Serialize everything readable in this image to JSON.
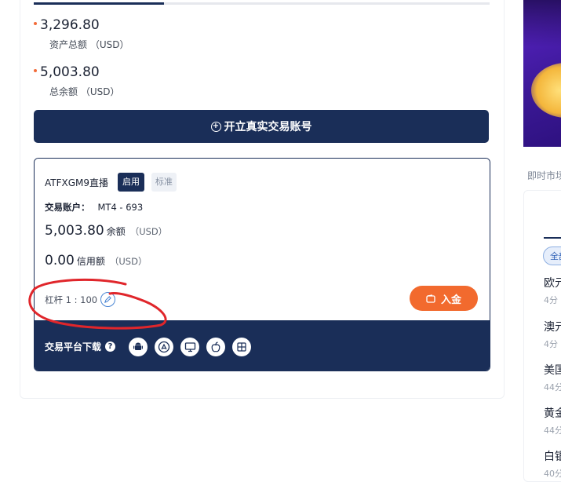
{
  "summary": {
    "total_assets": {
      "value": "3,296.80",
      "label": "资产总额 （USD）"
    },
    "total_balance": {
      "value": "5,003.80",
      "label": "总余额 （USD）"
    }
  },
  "open_account_button": {
    "icon": "plus-circle-icon",
    "label": "开立真实交易账号"
  },
  "account": {
    "name": "ATFXGM9直播",
    "status_badge": "启用",
    "type_badge": "标准",
    "account_label": "交易账户：",
    "account_value": "MT4 - 693",
    "balance": {
      "value": "5,003.80",
      "unit": "余额",
      "currency": "（USD）"
    },
    "credit": {
      "value": "0.00",
      "unit": "信用额",
      "currency": "（USD）"
    },
    "leverage": "杠杆 1 : 100",
    "deposit_button": "入金"
  },
  "platform_download": {
    "label": "交易平台下载",
    "icons": [
      "android-icon",
      "app-store-icon",
      "desktop-icon",
      "apple-icon",
      "windows-icon"
    ]
  },
  "right_panel": {
    "section_title": "即时市场",
    "filter_label": "全部",
    "items": [
      {
        "name": "欧元",
        "time": "4分"
      },
      {
        "name": "澳元",
        "time": "4分"
      },
      {
        "name": "美国",
        "time": "44分"
      },
      {
        "name": "黄金",
        "time": "44分"
      },
      {
        "name": "白银",
        "time": "40分"
      }
    ]
  },
  "colors": {
    "navy": "#1a2e58",
    "orange": "#f26a2e",
    "annotation_red": "#e0262b"
  }
}
